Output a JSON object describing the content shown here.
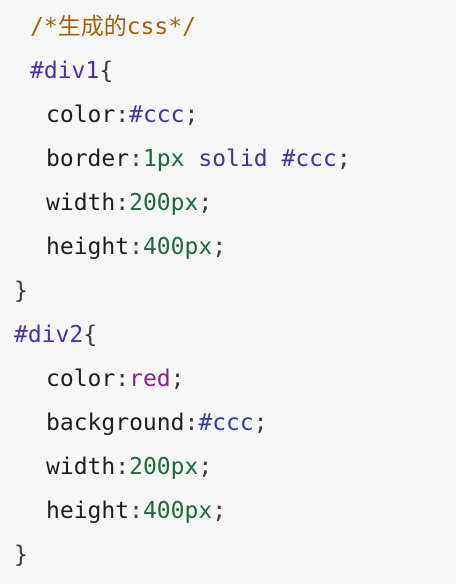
{
  "code": {
    "comment": "/*生成的css*/",
    "rules": [
      {
        "selector": "#div1",
        "open": "{",
        "close": "}",
        "decls": [
          {
            "prop": "color",
            "colon": ":",
            "value": "#ccc",
            "semi": ";"
          },
          {
            "prop": "border",
            "colon": ":",
            "num": "1px",
            "kw": "solid",
            "hex": "#ccc",
            "semi": ";"
          },
          {
            "prop": "width",
            "colon": ":",
            "value": "200px",
            "semi": ";"
          },
          {
            "prop": "height",
            "colon": ":",
            "value": "400px",
            "semi": ";"
          }
        ]
      },
      {
        "selector": "#div2",
        "open": "{",
        "close": "}",
        "decls": [
          {
            "prop": "color",
            "colon": ":",
            "value": "red",
            "semi": ";"
          },
          {
            "prop": "background",
            "colon": ":",
            "value": "#ccc",
            "semi": ";"
          },
          {
            "prop": "width",
            "colon": ":",
            "value": "200px",
            "semi": ";"
          },
          {
            "prop": "height",
            "colon": ":",
            "value": "400px",
            "semi": ";"
          }
        ]
      }
    ]
  },
  "colors": {
    "background": "#f7f7f8",
    "comment": "#a3610b",
    "selector": "#4b2fb0",
    "number": "#1c6b3c",
    "keyword": "#3b35a8",
    "named_color": "#8a1f8a"
  }
}
